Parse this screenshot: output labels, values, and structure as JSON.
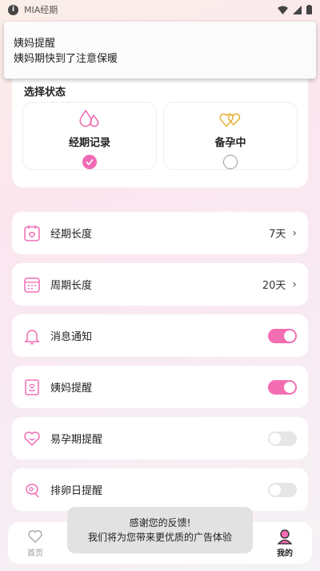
{
  "status_bar": {
    "app_name": "MIA经期"
  },
  "notification": {
    "title": "姨妈提醒",
    "body": "姨妈期快到了注意保暖"
  },
  "state": {
    "title": "选择状态",
    "options": [
      {
        "label": "经期记录",
        "icon": "water-drops-icon",
        "selected": true
      },
      {
        "label": "备孕中",
        "icon": "hearts-icon",
        "selected": false
      }
    ]
  },
  "settings": [
    {
      "label": "经期长度",
      "value": "7天",
      "icon": "calendar-heart-icon"
    },
    {
      "label": "周期长度",
      "value": "20天",
      "icon": "calendar-grid-icon"
    },
    {
      "label": "消息通知",
      "toggle": true,
      "icon": "bell-icon"
    },
    {
      "label": "姨妈提醒",
      "toggle": true,
      "icon": "note-heart-icon"
    },
    {
      "label": "易孕期提醒",
      "toggle": false,
      "icon": "heart-outline-icon"
    },
    {
      "label": "排卵日提醒",
      "toggle": false,
      "icon": "egg-icon"
    }
  ],
  "bottom_nav": {
    "home_label": "首页",
    "mine_label": "我的"
  },
  "toast": {
    "line1": "感谢您的反馈!",
    "line2": "我们将为您带来更优质的广告体验"
  },
  "colors": {
    "accent": "#f36db2",
    "toggle_off": "#e6e6e6"
  }
}
